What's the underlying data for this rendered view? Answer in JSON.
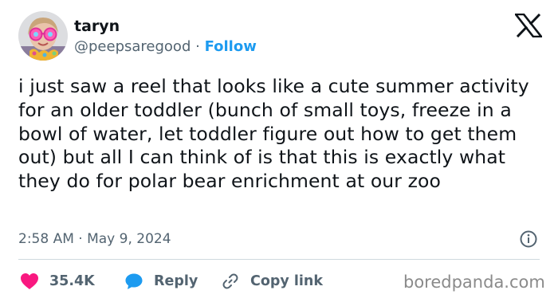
{
  "author": {
    "name": "taryn",
    "handle": "@peepsaregood",
    "separator": "·",
    "follow_label": "Follow"
  },
  "tweet": {
    "text": "i just saw a reel that looks like a cute summer activity for an older toddler (bunch of small toys, freeze in a bowl of water, let toddler figure out how to get them out) but all I can think of is that this is exactly what they do for polar bear enrichment at our zoo",
    "timestamp": "2:58 AM · May 9, 2024"
  },
  "actions": {
    "likes": "35.4K",
    "reply_label": "Reply",
    "copy_label": "Copy link"
  },
  "watermark": "boredpanda.com",
  "icons": {
    "platform": "x-logo-icon",
    "info": "info-icon",
    "like": "heart-icon",
    "reply": "speech-bubble-icon",
    "copy": "link-icon"
  },
  "colors": {
    "accent": "#1d9bf0",
    "like": "#f91880",
    "muted": "#536471"
  }
}
